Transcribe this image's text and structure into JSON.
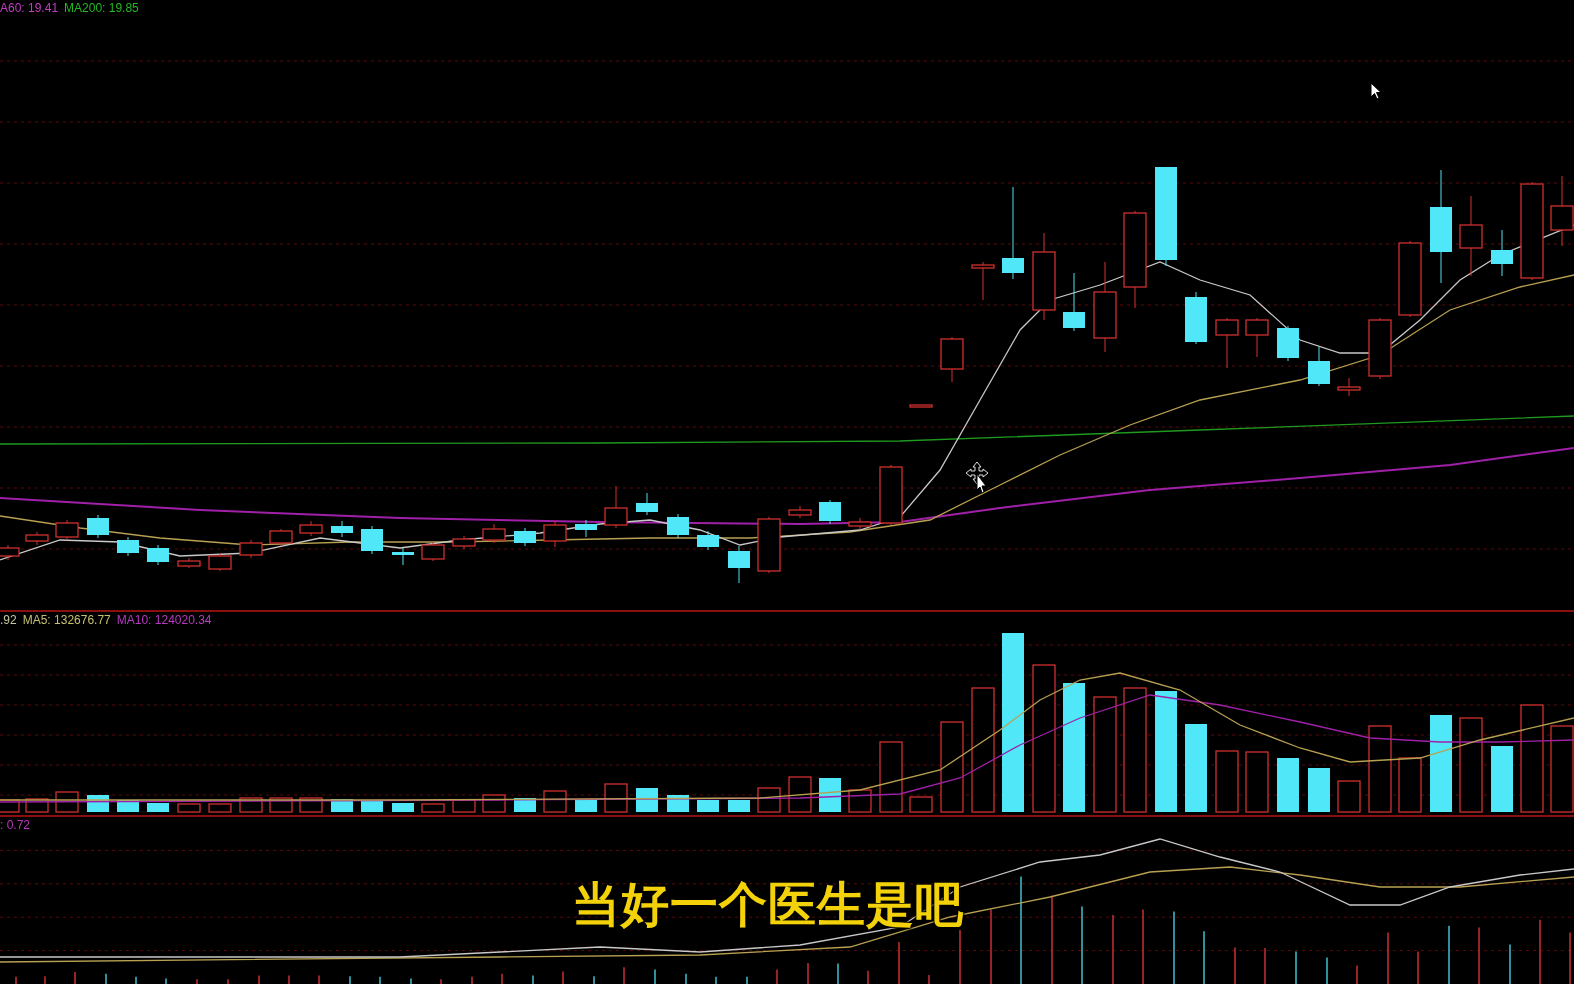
{
  "price_panel": {
    "legend": [
      {
        "text": "A60: 19.41",
        "color": "#c43cc4"
      },
      {
        "text": "MA200: 19.85",
        "color": "#22b822"
      }
    ]
  },
  "volume_panel": {
    "legend": [
      {
        "text": ".92",
        "color": "#c8c8a0"
      },
      {
        "text": "MA5: 132676.77",
        "color": "#c8c070"
      },
      {
        "text": "MA10: 124020.34",
        "color": "#b838c0"
      }
    ]
  },
  "macd_panel": {
    "legend": [
      {
        "text": ": 0.72",
        "color": "#b838c0"
      }
    ]
  },
  "subtitle": "当好一个医生是吧"
}
